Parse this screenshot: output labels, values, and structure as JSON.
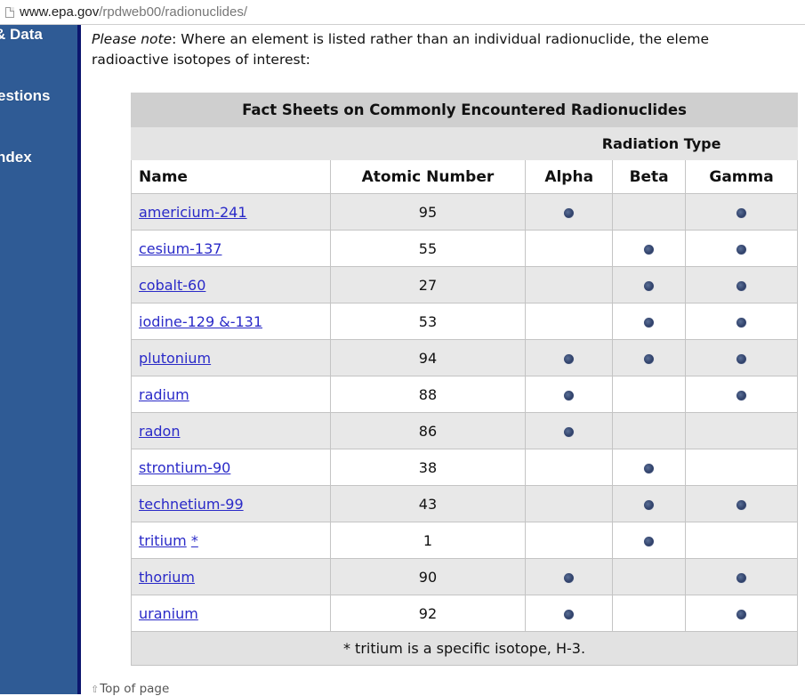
{
  "browser": {
    "url_host": "www.epa.gov",
    "url_path": "/rpdweb00/radionuclides/"
  },
  "sidebar": {
    "items": [
      {
        "label": "& Data"
      },
      {
        "label": "estions"
      },
      {
        "label": "ndex"
      }
    ],
    "colors": {
      "background": "#2f5b95",
      "edge": "#0c166e"
    }
  },
  "note": {
    "emphasis": "Please note",
    "line1_rest": ": Where an element is listed rather than an individual radionuclide, the eleme",
    "line2": "radioactive isotopes of interest:"
  },
  "table": {
    "title": "Fact Sheets on Commonly Encountered Radionuclides",
    "group_header": "Radiation Type",
    "columns": [
      "Name",
      "Atomic Number",
      "Alpha",
      "Beta",
      "Gamma"
    ],
    "rows": [
      {
        "name": "americium-241",
        "atomic_number": "95",
        "alpha": true,
        "beta": false,
        "gamma": true
      },
      {
        "name": "cesium-137",
        "atomic_number": "55",
        "alpha": false,
        "beta": true,
        "gamma": true
      },
      {
        "name": "cobalt-60",
        "atomic_number": "27",
        "alpha": false,
        "beta": true,
        "gamma": true
      },
      {
        "name": "iodine-129 &-131",
        "atomic_number": "53",
        "alpha": false,
        "beta": true,
        "gamma": true
      },
      {
        "name": "plutonium",
        "atomic_number": "94",
        "alpha": true,
        "beta": true,
        "gamma": true
      },
      {
        "name": "radium",
        "atomic_number": "88",
        "alpha": true,
        "beta": false,
        "gamma": true
      },
      {
        "name": "radon",
        "atomic_number": "86",
        "alpha": true,
        "beta": false,
        "gamma": false
      },
      {
        "name": "strontium-90",
        "atomic_number": "38",
        "alpha": false,
        "beta": true,
        "gamma": false
      },
      {
        "name": "technetium-99",
        "atomic_number": "43",
        "alpha": false,
        "beta": true,
        "gamma": true
      },
      {
        "name": "tritium",
        "footnote_marker": "*",
        "atomic_number": "1",
        "alpha": false,
        "beta": true,
        "gamma": false
      },
      {
        "name": "thorium",
        "atomic_number": "90",
        "alpha": true,
        "beta": false,
        "gamma": true
      },
      {
        "name": "uranium",
        "atomic_number": "92",
        "alpha": true,
        "beta": false,
        "gamma": true
      }
    ],
    "footnote": "* tritium is a specific isotope, H-3.",
    "indicator_icon": "bullet-dot"
  },
  "footer": {
    "top_link": "Top of page",
    "top_icon": "up-arrow-icon"
  }
}
